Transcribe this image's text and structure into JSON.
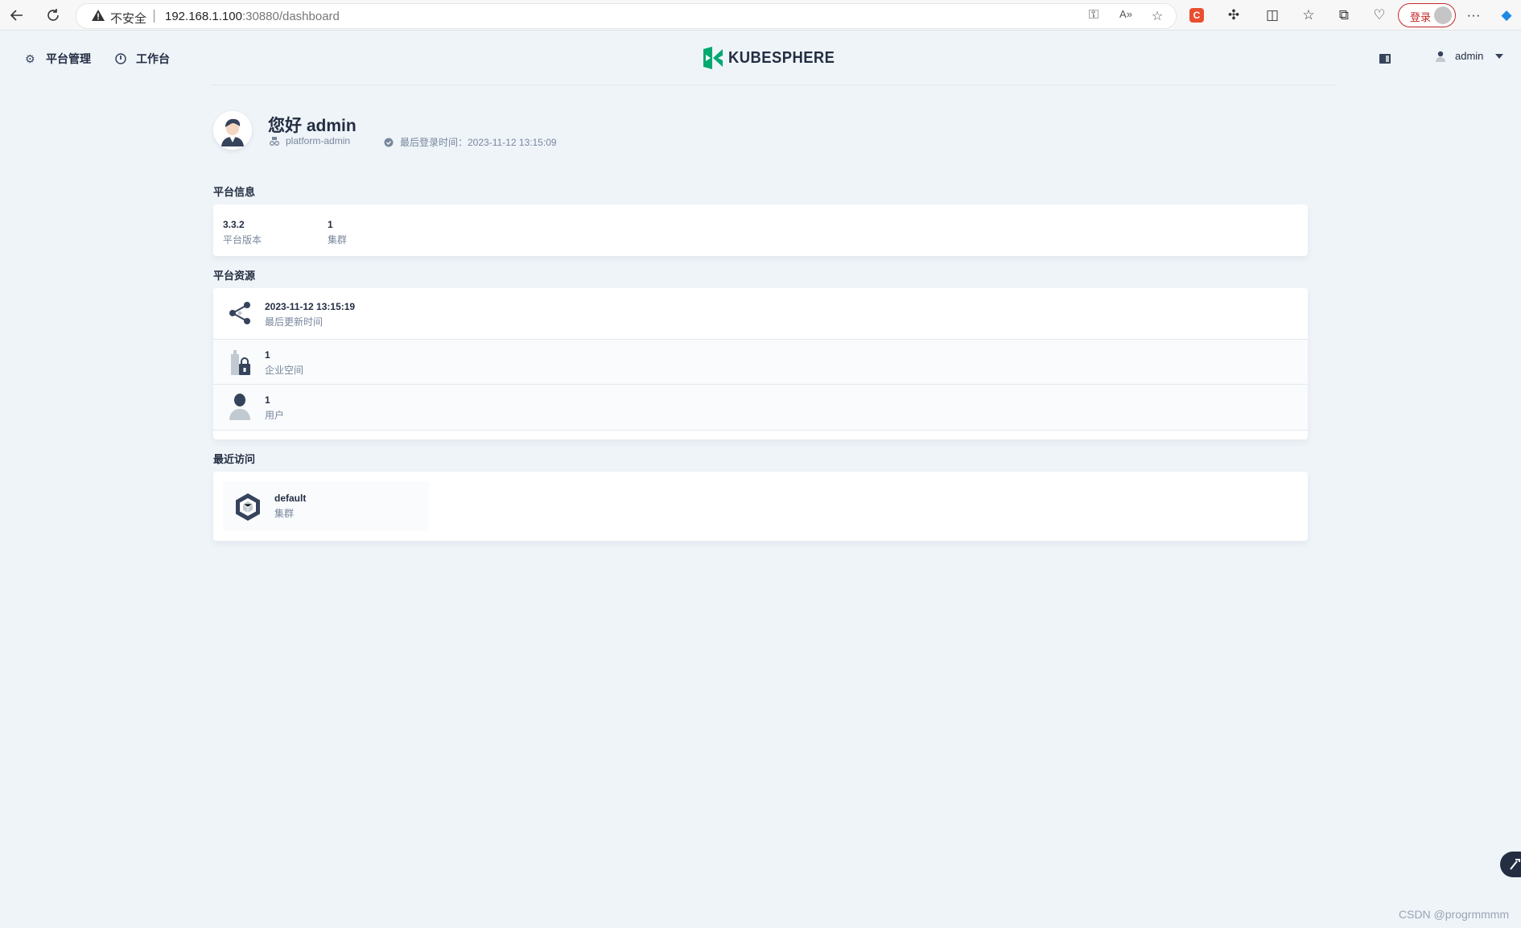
{
  "browser": {
    "security_label": "不安全",
    "url_host": "192.168.1.100",
    "url_rest": ":30880/dashboard",
    "login_label": "登录"
  },
  "header": {
    "nav": [
      {
        "label": "平台管理",
        "icon": "gear-icon"
      },
      {
        "label": "工作台",
        "icon": "compass-icon"
      }
    ],
    "logo_text": "KUBESPHERE",
    "brand_color": "#00a971",
    "user_name": "admin"
  },
  "profile": {
    "greeting": "您好 admin",
    "role": "platform-admin",
    "last_login": "最后登录时间：2023-11-12 13:15:09"
  },
  "platform_info": {
    "title": "平台信息",
    "items": [
      {
        "value": "3.3.2",
        "label": "平台版本"
      },
      {
        "value": "1",
        "label": "集群"
      }
    ]
  },
  "platform_resources": {
    "title": "平台资源",
    "rows": [
      {
        "value": "2023-11-12 13:15:19",
        "label": "最后更新时间",
        "icon": "share-nodes-icon"
      },
      {
        "value": "1",
        "label": "企业空间",
        "icon": "workspace-lock-icon"
      },
      {
        "value": "1",
        "label": "用户",
        "icon": "user-icon"
      }
    ]
  },
  "recent": {
    "title": "最近访问",
    "items": [
      {
        "name": "default",
        "type": "集群",
        "icon": "cluster-hex-icon"
      }
    ]
  },
  "watermark": "CSDN @progrmmmm"
}
